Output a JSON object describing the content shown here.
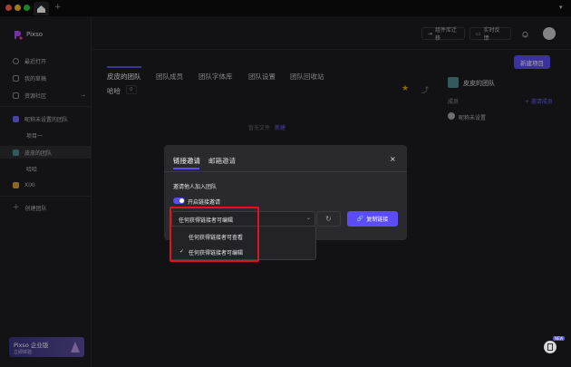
{
  "app": {
    "name": "Pixso"
  },
  "sidebar": {
    "items": [
      {
        "label": "最近打开"
      },
      {
        "label": "我的草稿"
      },
      {
        "label": "资源社区"
      },
      {
        "label": "昵称未设置的团队"
      },
      {
        "label": "项目一"
      },
      {
        "label": "皮皮的团队"
      },
      {
        "label": "哈哈"
      },
      {
        "label": "XIXI"
      },
      {
        "label": "创建团队"
      }
    ],
    "promo": {
      "title": "Pixso 企业版",
      "subtitle": "立即体验"
    }
  },
  "header": {
    "buttons": [
      {
        "label": "组件库迁移"
      },
      {
        "label": "实时反馈"
      }
    ],
    "new_project": "新建项目"
  },
  "tabs": [
    {
      "label": "皮皮的团队"
    },
    {
      "label": "团队成员"
    },
    {
      "label": "团队字体库"
    },
    {
      "label": "团队设置"
    },
    {
      "label": "团队回收站"
    }
  ],
  "project": {
    "name": "哈哈",
    "count": "0"
  },
  "empty_state": {
    "text": "暂无文件",
    "link": "新建"
  },
  "right_panel": {
    "team_name": "皮皮的团队",
    "members_label": "成员",
    "invite_link": "+ 邀请成员",
    "member_name": "昵称未设置"
  },
  "dialog": {
    "tabs": [
      {
        "label": "链接邀请"
      },
      {
        "label": "邮箱邀请"
      }
    ],
    "section_label": "邀请他人加入团队",
    "toggle_label": "开启链接邀请",
    "select_value": "任何获得链接者可编辑",
    "copy_button": "复制链接",
    "options": [
      {
        "label": "任何获得链接者可查看",
        "selected": false
      },
      {
        "label": "任何获得链接者可编辑",
        "selected": true
      }
    ]
  },
  "badge": {
    "label": "NEW"
  },
  "colors": {
    "accent": "#5b4cf5",
    "highlight": "#e0141f",
    "active_sidebar": "#2e2e33"
  }
}
